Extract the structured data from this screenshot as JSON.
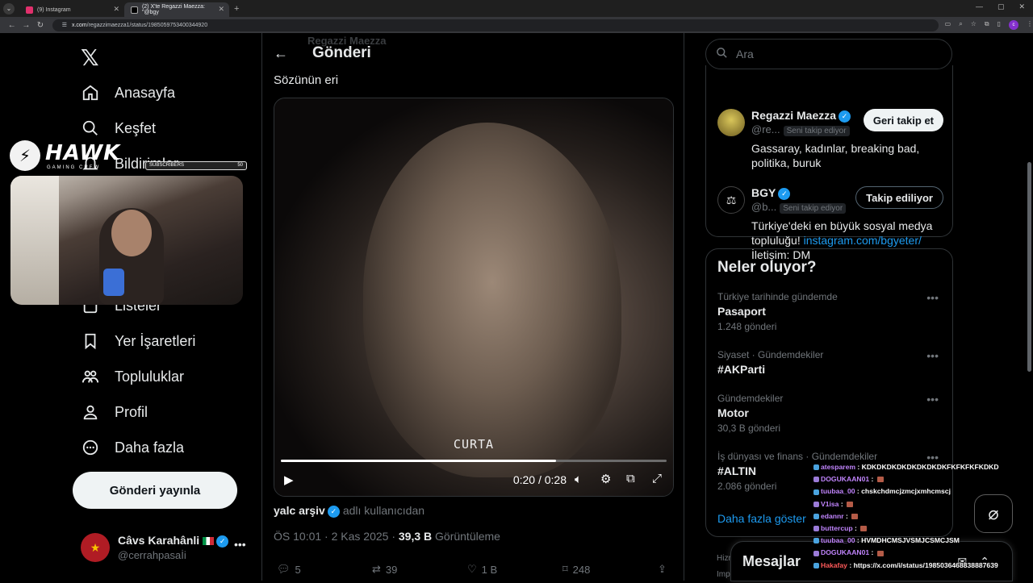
{
  "browser": {
    "tabs": [
      {
        "title": "(9) Instagram",
        "favicon_color": "#e1306c",
        "active": false
      },
      {
        "title": "(2) X'te Regazzi Maezza: \"@bgy",
        "favicon_color": "#ffffff",
        "active": true
      }
    ],
    "url_host": "x.com",
    "url_path": "/regazzimaezza1/status/1985059753400344920"
  },
  "nav": {
    "items": [
      {
        "label": "Anasayfa",
        "icon": "home-icon"
      },
      {
        "label": "Keşfet",
        "icon": "search-icon"
      },
      {
        "label": "Bildirimler",
        "icon": "bell-icon"
      },
      {
        "label": "Listeler",
        "icon": "list-icon"
      },
      {
        "label": "Yer İşaretleri",
        "icon": "bookmark-icon"
      },
      {
        "label": "Topluluklar",
        "icon": "communities-icon"
      },
      {
        "label": "Profil",
        "icon": "profile-icon"
      },
      {
        "label": "Daha fazla",
        "icon": "more-circle-icon"
      }
    ],
    "post_button": "Gönderi yayınla",
    "me": {
      "name": "Câvs Karahânli",
      "handle": "@cerrahpasaİi"
    }
  },
  "overlay": {
    "brand": "HAWK",
    "brand_sub": "GAMING CREW",
    "sub_label": "SUBSCRIBERS",
    "sub_count": "50"
  },
  "post": {
    "header_title": "Gönderi",
    "ghost_author": "Regazzi Maezza",
    "text": "Sözünün eri",
    "video": {
      "caption": "CURTA",
      "current": "0:20",
      "duration": "0:28",
      "time_text": "0:20 / 0:28",
      "progress": 0.714
    },
    "attribution_name": "yalc arşiv",
    "attribution_suffix": "adlı kullanıcıdan",
    "timestamp": "ÖS 10:01 · 2 Kas 2025 ·",
    "views": "39,3 B",
    "views_label": "Görüntüleme",
    "stats": {
      "replies": "5",
      "reposts": "39",
      "likes": "1 B",
      "bookmarks": "248"
    }
  },
  "sidebar": {
    "search_placeholder": "Ara",
    "people": [
      {
        "name": "Regazzi Maezza",
        "handle": "@re...",
        "tag": "Seni takip ediyor",
        "button": "Geri takip et",
        "bio": "Gassaray, kadınlar, breaking bad, politika, buruk"
      },
      {
        "name": "BGY",
        "handle": "@b...",
        "tag": "Seni takip ediyor",
        "button": "Takip ediliyor",
        "bio_before": "Türkiye'deki en büyük sosyal medya topluluğu! ",
        "bio_link": "instagram.com/bgyeter/",
        "bio_after": "İletişim: DM"
      }
    ],
    "trends_title": "Neler oluyor?",
    "trends": [
      {
        "context": "Türkiye tarihinde gündemde",
        "name": "Pasaport",
        "count": "1.248 gönderi"
      },
      {
        "context": "Siyaset · Gündemdekiler",
        "name": "#AKParti",
        "count": ""
      },
      {
        "context": "Gündemdekiler",
        "name": "Motor",
        "count": "30,3 B gönderi"
      },
      {
        "context": "İş dünyası ve finans · Gündemdekiler",
        "name": "#ALTIN",
        "count": "2.086 gönderi"
      }
    ],
    "show_more": "Daha fazla göster",
    "footer_lines": [
      "Hizm",
      "Imp"
    ]
  },
  "messages": {
    "title": "Mesajlar"
  },
  "chat": [
    {
      "user": "atesparem",
      "color": "#c084fc",
      "msg": "KDKDKDKDKDKDKDKDKFKFKFKFKDKD"
    },
    {
      "user": "DOGUKAAN01",
      "color": "#c084fc",
      "msg": ""
    },
    {
      "user": "tuubaa_00",
      "color": "#c084fc",
      "msg": "chskchdmcjzmcjxmhcmscj"
    },
    {
      "user": "V1isa",
      "color": "#c084fc",
      "msg": ""
    },
    {
      "user": "edannr",
      "color": "#c084fc",
      "msg": ""
    },
    {
      "user": "buttercup",
      "color": "#c084fc",
      "msg": ""
    },
    {
      "user": "tuubaa_00",
      "color": "#c084fc",
      "msg": "HVMDHCMSJVSMJCSMCJSM"
    },
    {
      "user": "DOGUKAAN01",
      "color": "#c084fc",
      "msg": ""
    },
    {
      "user": "Hakafay",
      "color": "#ff5a5a",
      "msg": "https://x.com/i/status/1985036468838887639"
    }
  ]
}
